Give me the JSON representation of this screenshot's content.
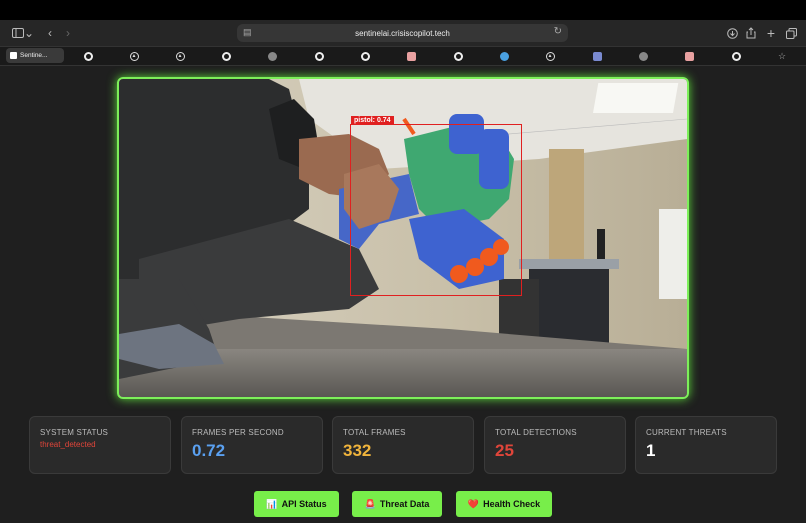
{
  "browser": {
    "url": "sentinelai.crisiscopilot.tech",
    "active_tab_label": "Sentine..."
  },
  "detection": {
    "label": "pistol: 0.74"
  },
  "stats": {
    "system_status_label": "SYSTEM STATUS",
    "system_status_value": "threat_detected",
    "fps_label": "FRAMES PER SECOND",
    "fps_value": "0.72",
    "total_frames_label": "TOTAL FRAMES",
    "total_frames_value": "332",
    "total_detections_label": "TOTAL DETECTIONS",
    "total_detections_value": "25",
    "current_threats_label": "CURRENT THREATS",
    "current_threats_value": "1"
  },
  "colors": {
    "fps": "#5aa0f0",
    "frames": "#f0b43c",
    "detections": "#e0453a",
    "threats": "#ffffff",
    "accent": "#78ee4a"
  },
  "buttons": {
    "api_status": "API Status",
    "threat_data": "Threat Data",
    "health_check": "Health Check"
  },
  "icons": {
    "api_status": "chart-icon",
    "threat_data": "alarm-icon",
    "health_check": "heart-icon"
  }
}
